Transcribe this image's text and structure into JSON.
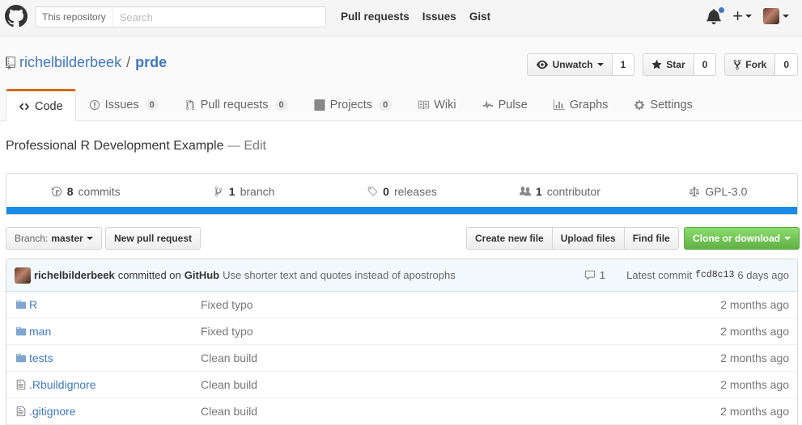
{
  "header": {
    "search_scope": "This repository",
    "search_placeholder": "Search",
    "nav": [
      "Pull requests",
      "Issues",
      "Gist"
    ],
    "plus_label": "+"
  },
  "repo": {
    "owner": "richelbilderbeek",
    "separator": "/",
    "name": "prde",
    "watch_label": "Unwatch",
    "watch_count": "1",
    "star_label": "Star",
    "star_count": "0",
    "fork_label": "Fork",
    "fork_count": "0"
  },
  "tabs": [
    {
      "label": "Code",
      "icon": "code-icon",
      "selected": true
    },
    {
      "label": "Issues",
      "icon": "issue-icon",
      "count": "0"
    },
    {
      "label": "Pull requests",
      "icon": "pull-request-icon",
      "count": "0"
    },
    {
      "label": "Projects",
      "icon": "project-icon",
      "count": "0"
    },
    {
      "label": "Wiki",
      "icon": "book-icon"
    },
    {
      "label": "Pulse",
      "icon": "pulse-icon"
    },
    {
      "label": "Graphs",
      "icon": "graph-icon"
    },
    {
      "label": "Settings",
      "icon": "gear-icon"
    }
  ],
  "description": {
    "text": "Professional R Development Example",
    "edit": "— Edit"
  },
  "stats": {
    "commits_num": "8",
    "commits_label": "commits",
    "branch_num": "1",
    "branch_label": "branch",
    "releases_num": "0",
    "releases_label": "releases",
    "contrib_num": "1",
    "contrib_label": "contributor",
    "license": "GPL-3.0",
    "lang_color": "#198ce7"
  },
  "filenav": {
    "branch_label": "Branch:",
    "branch_value": "master",
    "new_pr": "New pull request",
    "create_file": "Create new file",
    "upload_files": "Upload files",
    "find_file": "Find file",
    "clone": "Clone or download"
  },
  "commit": {
    "author": "richelbilderbeek",
    "action": "committed on",
    "via": "GitHub",
    "message": "Use shorter text and quotes instead of apostrophs",
    "comments": "1",
    "latest_label": "Latest commit",
    "sha": "fcd8c13",
    "age": "6 days ago"
  },
  "files": [
    {
      "type": "folder",
      "name": "R",
      "message": "Fixed typo",
      "age": "2 months ago"
    },
    {
      "type": "folder",
      "name": "man",
      "message": "Fixed typo",
      "age": "2 months ago"
    },
    {
      "type": "folder",
      "name": "tests",
      "message": "Clean build",
      "age": "2 months ago"
    },
    {
      "type": "file",
      "name": ".Rbuildignore",
      "message": "Clean build",
      "age": "2 months ago"
    },
    {
      "type": "file",
      "name": ".gitignore",
      "message": "Clean build",
      "age": "2 months ago"
    }
  ]
}
